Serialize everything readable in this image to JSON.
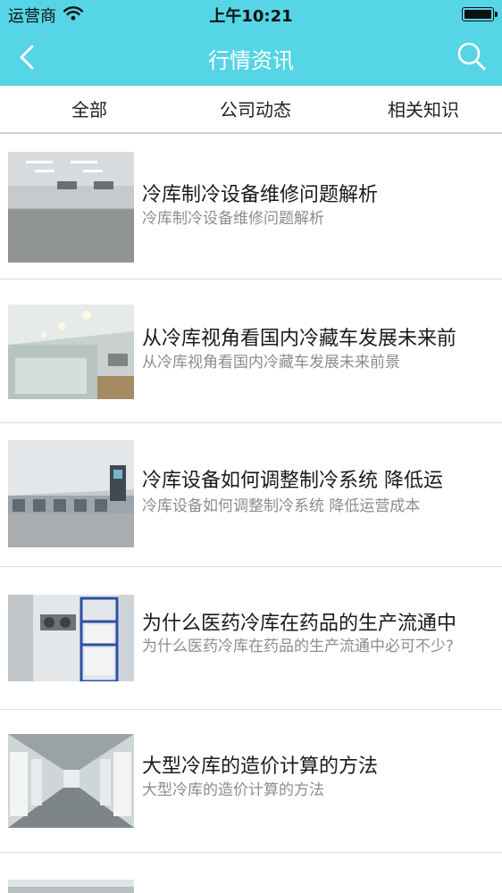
{
  "status_bar": {
    "carrier": "运营商",
    "time": "上午10:21"
  },
  "header": {
    "title": "行情资讯",
    "back_icon": "chevron-left-icon",
    "search_icon": "search-icon",
    "background_color": "#55d5e6"
  },
  "tabs": [
    {
      "label": "全部"
    },
    {
      "label": "公司动态"
    },
    {
      "label": "相关知识"
    }
  ],
  "articles": [
    {
      "title": "冷库制冷设备维修问题解析",
      "summary": "冷库制冷设备维修问题解析"
    },
    {
      "title": "从冷库视角看国内冷藏车发展未来前",
      "summary": "从冷库视角看国内冷藏车发展未来前景"
    },
    {
      "title": "冷库设备如何调整制冷系统 降低运",
      "summary": "冷库设备如何调整制冷系统 降低运营成本"
    },
    {
      "title": "为什么医药冷库在药品的生产流通中",
      "summary": "为什么医药冷库在药品的生产流通中必可不少?"
    },
    {
      "title": "大型冷库的造价计算的方法",
      "summary": "大型冷库的造价计算的方法"
    }
  ]
}
